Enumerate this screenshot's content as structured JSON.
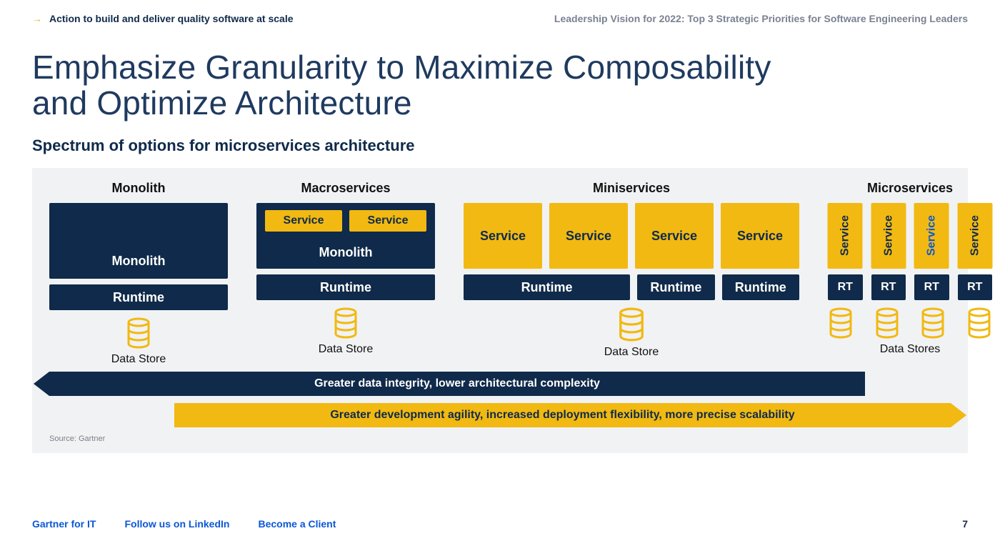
{
  "header": {
    "left": "Action to build and deliver quality software at scale",
    "right": "Leadership Vision for 2022: Top 3 Strategic Priorities for Software Engineering Leaders"
  },
  "title_line1": "Emphasize Granularity to Maximize Composability",
  "title_line2": "and Optimize Architecture",
  "subtitle": "Spectrum of options for microservices architecture",
  "columns": {
    "monolith": {
      "label": "Monolith",
      "box": "Monolith",
      "runtime": "Runtime",
      "store": "Data Store"
    },
    "macro": {
      "label": "Macroservices",
      "service": "Service",
      "monolith": "Monolith",
      "runtime": "Runtime",
      "store": "Data Store"
    },
    "mini": {
      "label": "Miniservices",
      "service": "Service",
      "runtime": "Runtime",
      "store": "Data Store"
    },
    "micro": {
      "label": "Microservices",
      "service": "Service",
      "rt": "RT",
      "store": "Data Stores"
    }
  },
  "arrows": {
    "left": "Greater data integrity, lower architectural complexity",
    "right": "Greater development agility, increased deployment flexibility, more precise scalability"
  },
  "source": "Source: Gartner",
  "footer": {
    "brand": "Gartner for IT",
    "linkedin": "Follow us on LinkedIn",
    "client": "Become a Client",
    "page": "7"
  },
  "icons": {
    "arrow_right": "→"
  }
}
